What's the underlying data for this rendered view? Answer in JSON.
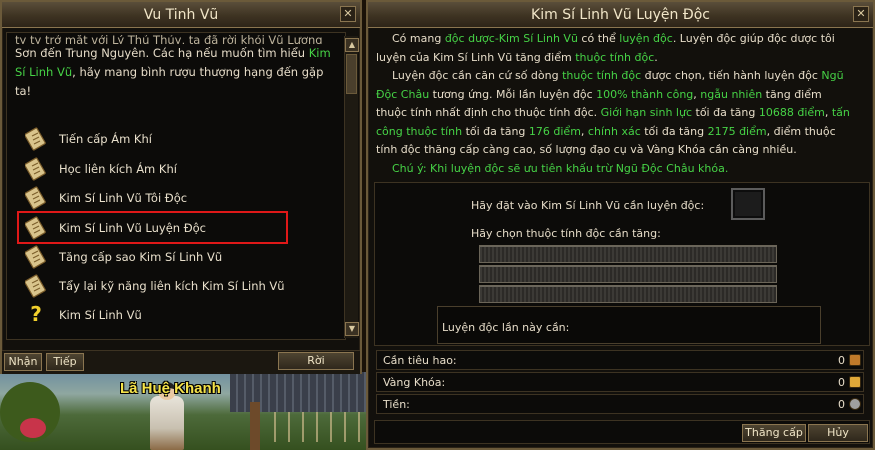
{
  "left_window": {
    "title": "Vu Tinh Vũ",
    "close": "✕",
    "dialog": {
      "line1": "ty ty trở mặt với Lý Thủ Thủy, ta đã rời khỏi Vũ Lượng",
      "line2_a": "Sơn đến Trung Nguyên. Các hạ nếu muốn tìm hiểu ",
      "line2_hl": "Kim",
      "line3_hl": "Sí Linh Vũ",
      "line3_b": ", hãy mang bình rượu thượng hạng đến gặp",
      "line4": "ta!"
    },
    "options": [
      {
        "label": "Tiến cấp Ám Khí",
        "icon": "scroll-icon"
      },
      {
        "label": "Học liên kích Ám Khí",
        "icon": "scroll-icon"
      },
      {
        "label": "Kim Sí Linh Vũ Tôi Độc",
        "icon": "scroll-icon"
      },
      {
        "label": "Kim Sí Linh Vũ Luyện Độc",
        "icon": "scroll-icon"
      },
      {
        "label": "Tăng cấp sao Kim Sí Linh Vũ",
        "icon": "scroll-icon"
      },
      {
        "label": "Tẩy lại kỹ năng liên kích Kim Sí Linh Vũ",
        "icon": "scroll-icon"
      },
      {
        "label": "Kim Sí Linh Vũ",
        "icon": "question-icon"
      }
    ],
    "buttons": {
      "accept": "Nhận",
      "next": "Tiếp",
      "leave": "Rời"
    }
  },
  "scene": {
    "npc_name": "Lã Huệ Khanh"
  },
  "right_window": {
    "title": "Kim Sí Linh Vũ Luyện Độc",
    "close": "✕",
    "desc": {
      "p1_a": "Có mang ",
      "p1_g1": "độc dược-Kim Sí Linh Vũ",
      "p1_b": " có thể ",
      "p1_g2": "luyện độc",
      "p1_c": ". Luyện độc giúp độc dược tôi",
      "p1_d": "luyện của Kim Sí Linh Vũ tăng điểm ",
      "p1_g3": "thuộc tính độc",
      "p1_e": ".",
      "p2_a": "Luyện độc cần căn cứ số dòng ",
      "p2_g1": "thuộc tính độc",
      "p2_b": " được chọn, tiến hành luyện độc ",
      "p2_g2": "Ngũ",
      "p2_g3": "Độc Châu",
      "p2_c": " tương ứng. Mỗi lần luyện độc ",
      "p2_g4": "100% thành công",
      "p2_d": ", ",
      "p2_g5": "ngẫu nhiên",
      "p2_e": " tăng điểm",
      "p2_f": "thuộc tính nhất định cho thuộc tính độc. ",
      "p2_g6": "Giới hạn sinh lực",
      "p2_g": " tối đa tăng ",
      "p2_g7": "10688 điểm",
      "p2_h": ", ",
      "p2_g8": "tấn",
      "p2_g9": "công thuộc tính",
      "p2_i": " tối đa tăng ",
      "p2_g10": "176 điểm",
      "p2_j": ", ",
      "p2_g11": "chính xác",
      "p2_k": " tối đa tăng ",
      "p2_g12": "2175 điểm",
      "p2_l": ", điểm thuộc",
      "p2_m": "tính độc thăng cấp càng cao, số lượng đạo cụ và Vàng Khóa cần càng nhiều.",
      "note": "Chú ý: Khi luyện độc sẽ ưu tiên khấu trừ Ngũ Độc Châu khóa."
    },
    "place_label": "Hãy đặt vào Kim Sí Linh Vũ cần luyện độc:",
    "choose_label": "Hãy chọn thuộc tính độc cần tăng:",
    "result_label": "Luyện độc lần này cần:",
    "rows": [
      {
        "label": "Cần tiêu hao:",
        "value": "0",
        "icon": "item-icon"
      },
      {
        "label": "Vàng Khóa:",
        "value": "0",
        "icon": "gold-ingot-icon"
      },
      {
        "label": "Tiền:",
        "value": "0",
        "icon": "coin-icon"
      }
    ],
    "buttons": {
      "upgrade": "Thăng cấp",
      "cancel": "Hủy"
    }
  }
}
